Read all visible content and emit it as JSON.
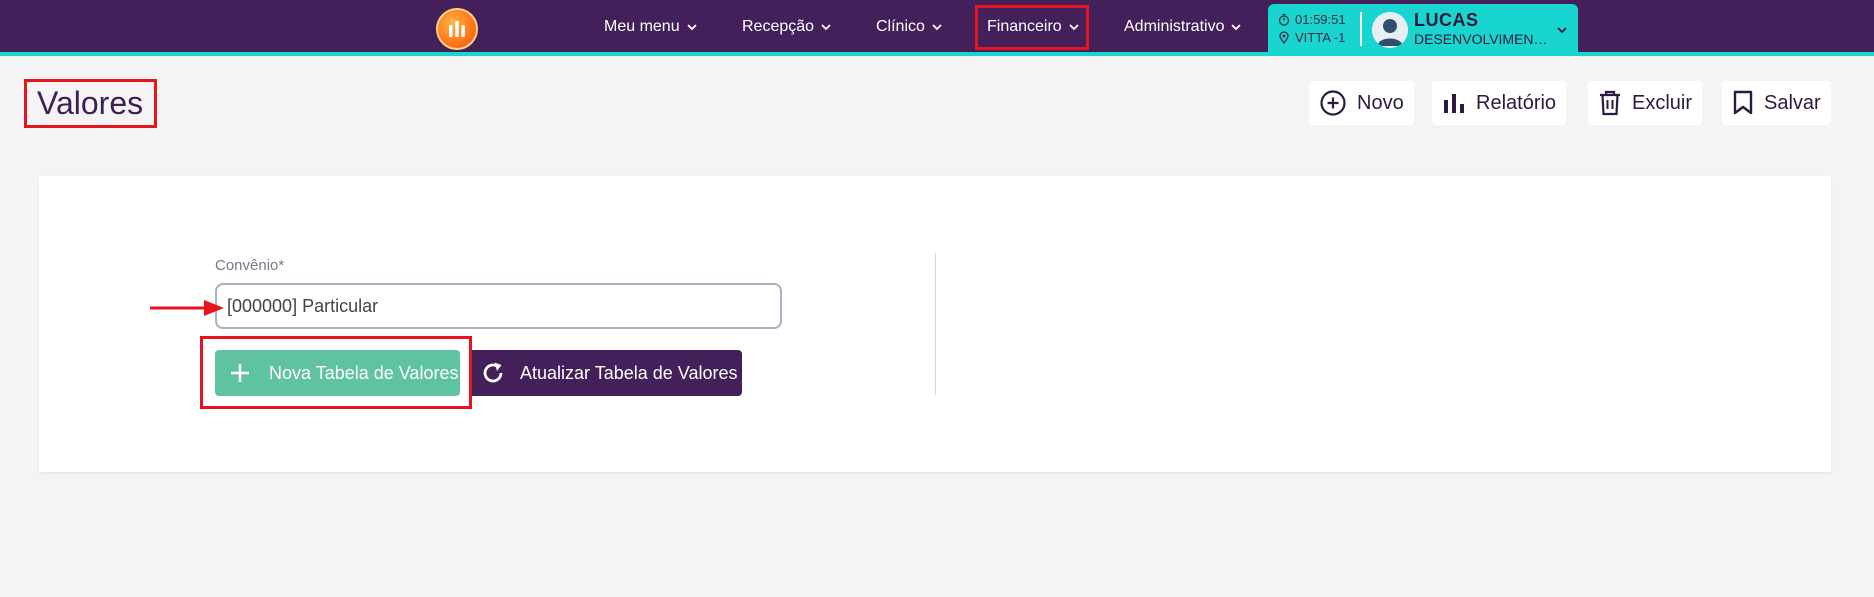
{
  "nav": {
    "items": [
      {
        "label": "Meu menu"
      },
      {
        "label": "Recepção"
      },
      {
        "label": "Clínico"
      },
      {
        "label": "Financeiro"
      },
      {
        "label": "Administrativo"
      }
    ],
    "logo_icon": "bar-chart-logo-icon",
    "colors": {
      "bar": "#43205a",
      "accent": "#19d5d0",
      "highlight": "#e8141d"
    }
  },
  "user": {
    "time": "01:59:51",
    "location": "VITTA -1",
    "name": "LUCAS",
    "role": "DESENVOLVIMENTO"
  },
  "page": {
    "title": "Valores"
  },
  "toolbar": {
    "novo_label": "Novo",
    "relatorio_label": "Relatório",
    "excluir_label": "Excluir",
    "salvar_label": "Salvar"
  },
  "form": {
    "convenio_label": "Convênio*",
    "convenio_value": "[000000] Particular"
  },
  "actions": {
    "nova_tabela_label": "Nova Tabela de Valores",
    "atualizar_tabela_label": "Atualizar Tabela de Valores",
    "nova_color": "#5fc2a0",
    "atualizar_color": "#43205a"
  }
}
